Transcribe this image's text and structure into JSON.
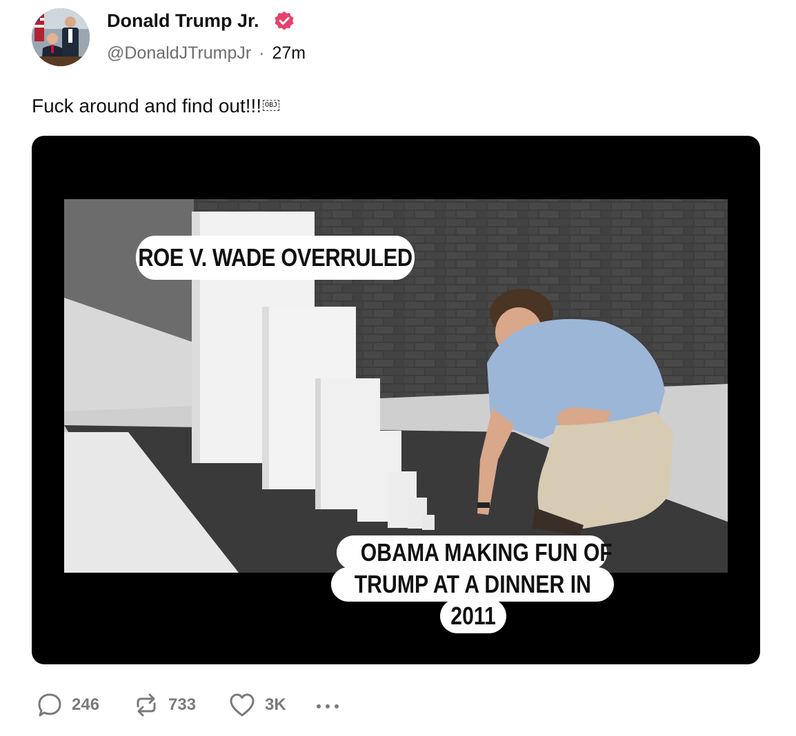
{
  "author": {
    "display_name": "Donald Trump Jr.",
    "handle": "@DonaldJTrumpJr",
    "separator": "·",
    "time": "27m",
    "verified_icon": "verified-badge-icon",
    "verified_color": "#e8416f"
  },
  "post": {
    "text": "Fuck around and find out!!!",
    "obj_glyph": "OBJ"
  },
  "media": {
    "caption_top": "ROE V. WADE OVERRULED",
    "caption_bottom_lines": [
      "OBAMA MAKING FUN OF",
      "TRUMP AT A DINNER IN",
      "2011"
    ]
  },
  "actions": {
    "reply_count": "246",
    "repost_count": "733",
    "like_count": "3K",
    "reply_icon": "reply-bubble-icon",
    "repost_icon": "repost-arrows-icon",
    "like_icon": "heart-icon",
    "more_icon": "more-dots-icon",
    "icon_color": "#7a7a7a"
  }
}
